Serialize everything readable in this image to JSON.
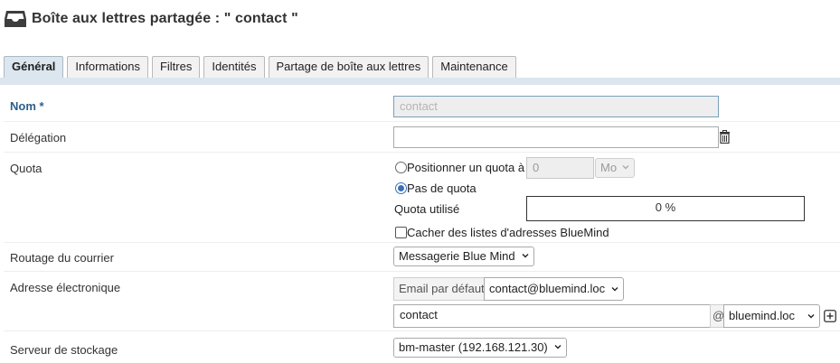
{
  "header": {
    "title": "Boîte aux lettres partagée : \" contact \"",
    "icon": "inbox-tray-icon"
  },
  "tabs": [
    {
      "label": "Général",
      "active": true
    },
    {
      "label": "Informations"
    },
    {
      "label": "Filtres"
    },
    {
      "label": "Identités"
    },
    {
      "label": "Partage de boîte aux lettres"
    },
    {
      "label": "Maintenance"
    }
  ],
  "form": {
    "name": {
      "label": "Nom *",
      "value": "contact"
    },
    "delegation": {
      "label": "Délégation",
      "value": "",
      "icon": "trash-icon"
    },
    "quota": {
      "label": "Quota",
      "set_quota_label": "Positionner un quota à",
      "quota_value": "0",
      "unit": "Mo",
      "no_quota_label": "Pas de quota",
      "used_label": "Quota utilisé",
      "used_value": "0 %"
    },
    "hide_lists": {
      "label": "Cacher des listes d'adresses BlueMind",
      "checked": false
    },
    "routing": {
      "label": "Routage du courrier",
      "value": "Messagerie Blue Mind"
    },
    "email": {
      "label": "Adresse électronique",
      "default_label": "Email par défaut",
      "default_value": "contact@bluemind.loc",
      "local_part": "contact",
      "at": "@",
      "domain": "bluemind.loc",
      "add_icon": "plus-square-icon"
    },
    "server": {
      "label": "Serveur de stockage",
      "value": "bm-master (192.168.121.30)"
    }
  },
  "colors": {
    "tab_active_bg": "#dbe6ef",
    "required_label": "#2b5f8c",
    "radio_accent": "#3b6fb6"
  }
}
